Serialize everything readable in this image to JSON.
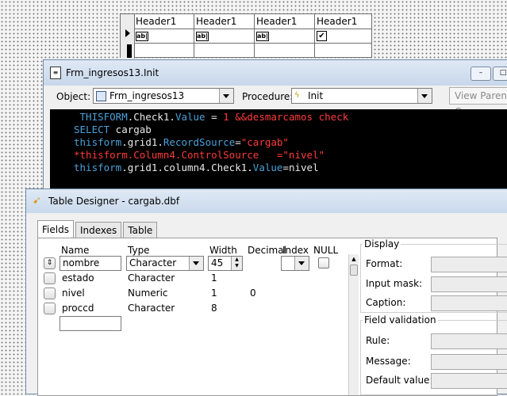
{
  "grid": {
    "headers": [
      "Header1",
      "Header1",
      "Header1",
      "Header1"
    ],
    "cells": [
      {
        "icon": "textbox-icon",
        "glyph": "ab|"
      },
      {
        "icon": "textbox-icon",
        "glyph": "ab|"
      },
      {
        "icon": "textbox-icon",
        "glyph": "ab|"
      },
      {
        "icon": "checkbox-checked-icon",
        "glyph": "✔"
      }
    ]
  },
  "code_window": {
    "title": "Frm_ingresos13.Init",
    "object_label": "Object:",
    "object_value": "Frm_ingresos13",
    "procedure_label": "Procedure:",
    "procedure_value": "Init",
    "view_parent_button": "View Parent C",
    "window_buttons": [
      "–",
      "□"
    ],
    "code_lines": [
      [
        {
          "t": " THISFORM",
          "c": "c-kw"
        },
        {
          "t": ".Check1.",
          "c": "c-pl"
        },
        {
          "t": "Value",
          "c": "c-kw"
        },
        {
          "t": " = ",
          "c": "c-pl"
        },
        {
          "t": "1",
          "c": "c-num"
        },
        {
          "t": " &&desmarcamos check",
          "c": "c-com"
        }
      ],
      [
        {
          "t": "SELECT",
          "c": "c-kw"
        },
        {
          "t": " cargab",
          "c": "c-pl"
        }
      ],
      [
        {
          "t": "thisform",
          "c": "c-kw"
        },
        {
          "t": ".grid1.",
          "c": "c-pl"
        },
        {
          "t": "RecordSource",
          "c": "c-kw"
        },
        {
          "t": "=",
          "c": "c-pl"
        },
        {
          "t": "\"cargab\"",
          "c": "c-str"
        }
      ],
      [
        {
          "t": "*thisform.Column4.ControlSource   =\"nivel\"",
          "c": "c-com"
        }
      ],
      [
        {
          "t": "thisform",
          "c": "c-kw"
        },
        {
          "t": ".grid1.column4.Check1.",
          "c": "c-pl"
        },
        {
          "t": "Value",
          "c": "c-kw"
        },
        {
          "t": "=nivel",
          "c": "c-pl"
        }
      ]
    ]
  },
  "table_designer": {
    "title": "Table Designer - cargab.dbf",
    "tabs": [
      "Fields",
      "Indexes",
      "Table"
    ],
    "active_tab": "Fields",
    "columns": {
      "name": "Name",
      "type": "Type",
      "width": "Width",
      "decimal": "Decimal",
      "index": "Index",
      "null": "NULL"
    },
    "rows": [
      {
        "name": "nombre",
        "type": "Character",
        "width": "45",
        "decimal": "",
        "editing": true
      },
      {
        "name": "estado",
        "type": "Character",
        "width": "1",
        "decimal": ""
      },
      {
        "name": "nivel",
        "type": "Numeric",
        "width": "1",
        "decimal": "0"
      },
      {
        "name": "proccd",
        "type": "Character",
        "width": "8",
        "decimal": ""
      }
    ],
    "display": {
      "legend": "Display",
      "format": "Format:",
      "input_mask": "Input mask:",
      "caption": "Caption:"
    },
    "field_validation": {
      "legend": "Field validation",
      "rule": "Rule:",
      "message": "Message:",
      "default_value": "Default value:"
    }
  }
}
